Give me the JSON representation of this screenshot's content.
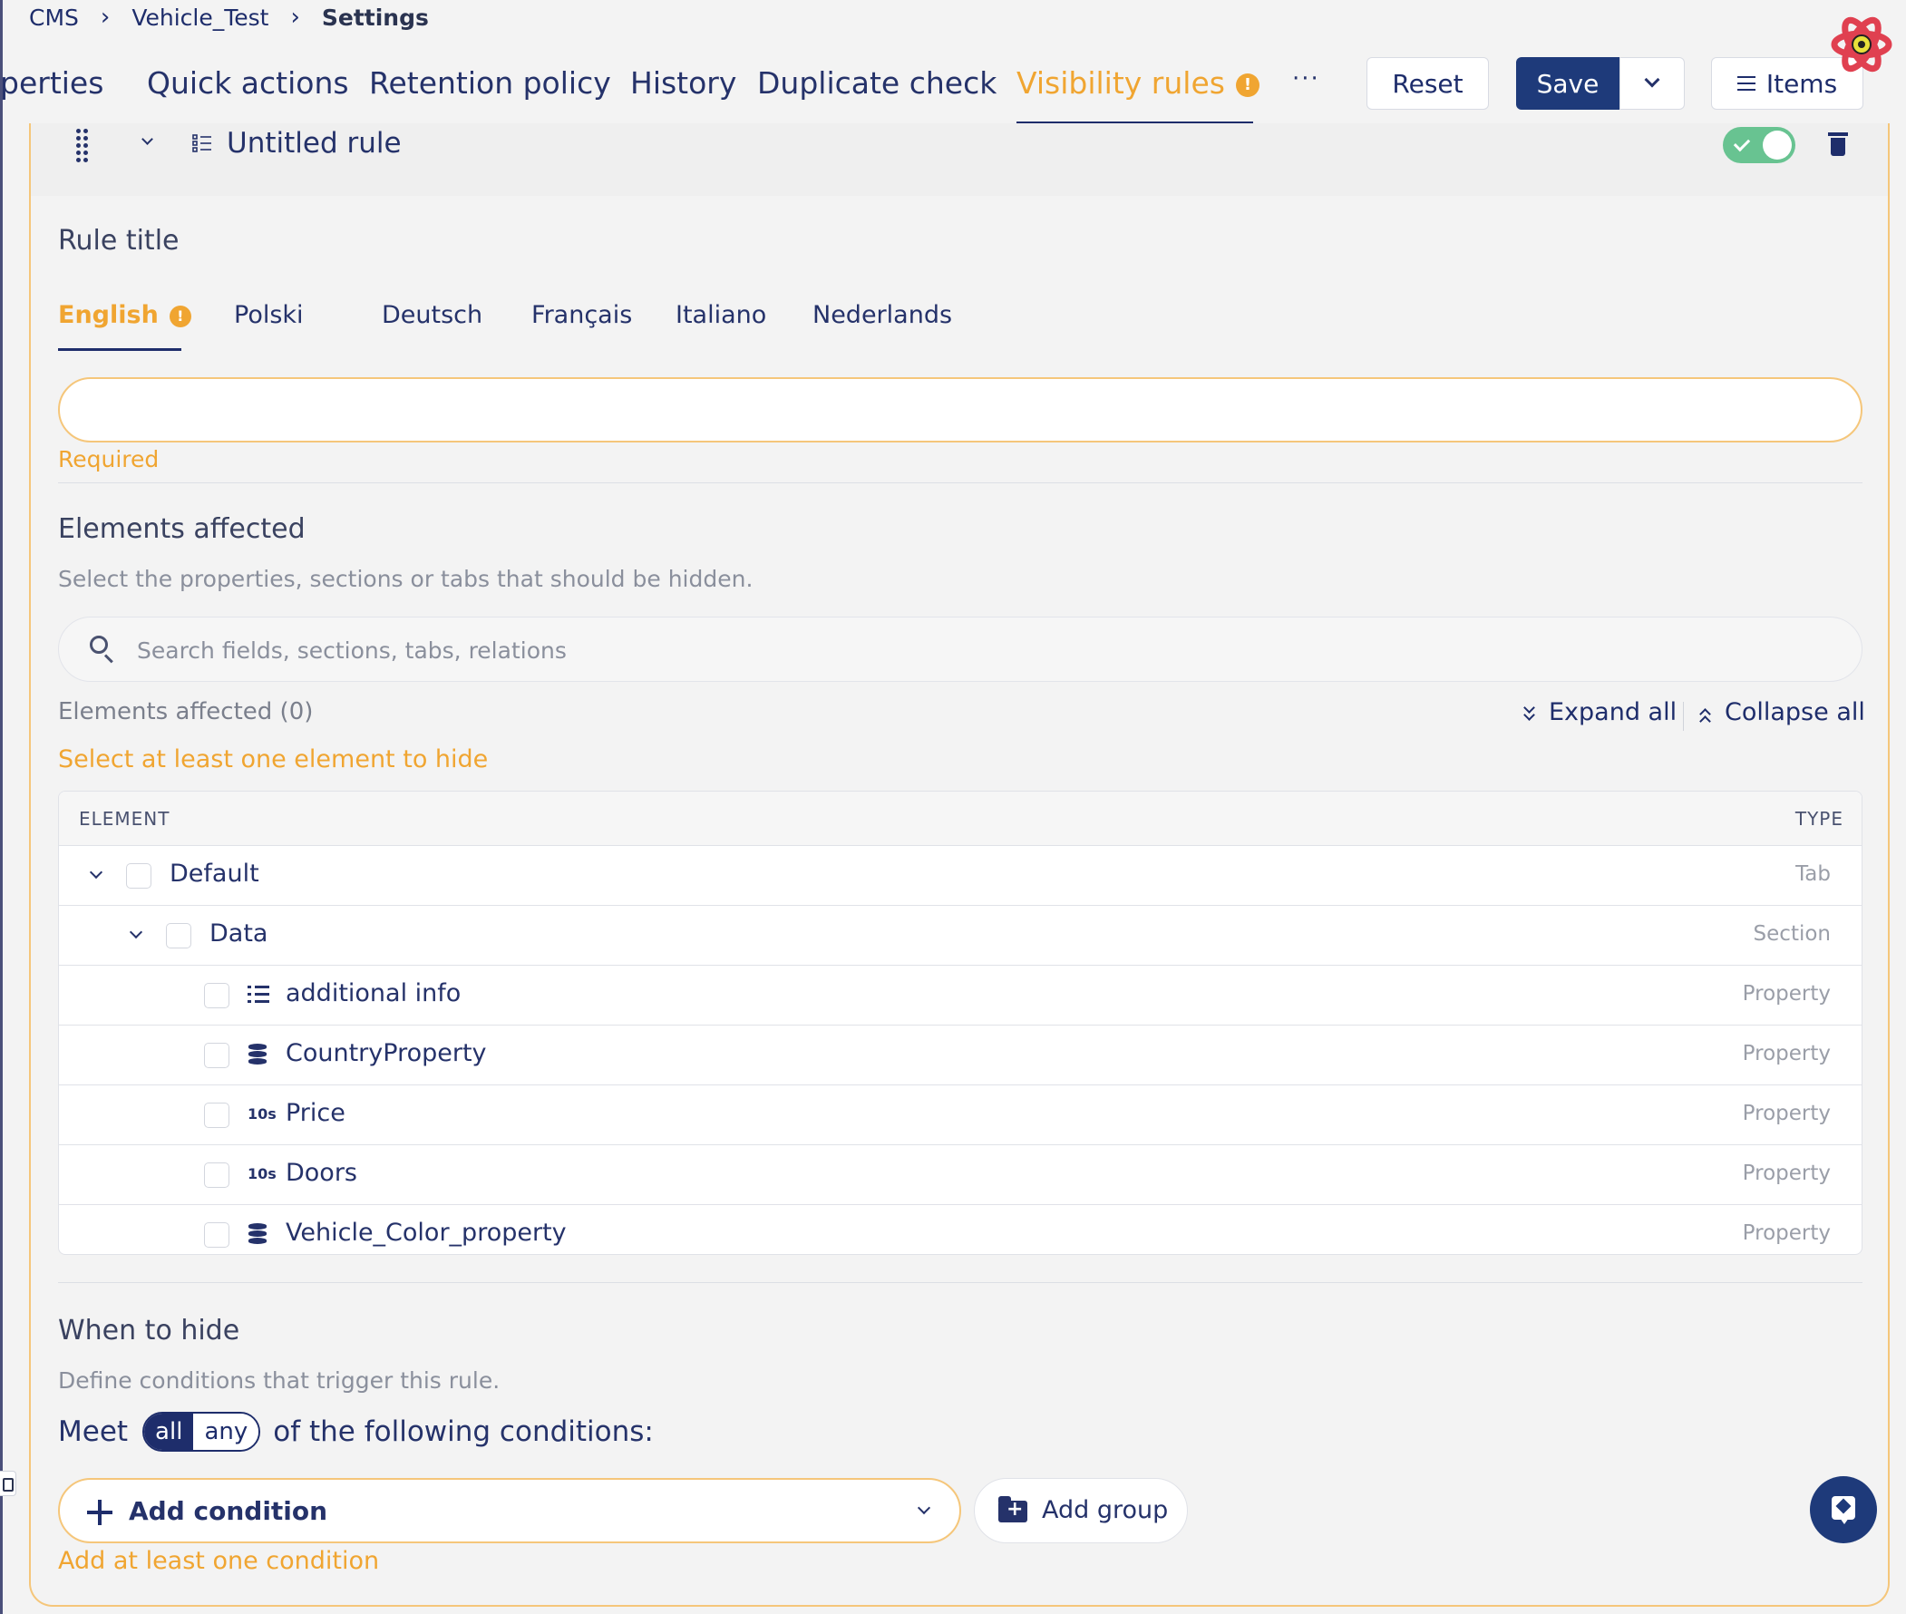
{
  "breadcrumb": {
    "items": [
      "CMS",
      "Vehicle_Test"
    ],
    "current": "Settings"
  },
  "tabs": {
    "properties": "perties",
    "quick_actions": "Quick actions",
    "retention_policy": "Retention policy",
    "history": "History",
    "duplicate_check": "Duplicate check",
    "visibility_rules": "Visibility rules",
    "more": "···"
  },
  "toolbar": {
    "reset": "Reset",
    "save": "Save",
    "items": "Items"
  },
  "rule": {
    "title": "Untitled rule",
    "enabled": true,
    "title_label": "Rule title",
    "languages": [
      "English",
      "Polski",
      "Deutsch",
      "Français",
      "Italiano",
      "Nederlands"
    ],
    "active_language": "English",
    "title_value": "",
    "title_error": "Required"
  },
  "elements": {
    "heading": "Elements affected",
    "description": "Select the properties, sections or tabs that should be hidden.",
    "search_placeholder": "Search fields, sections, tabs, relations",
    "count_label": "Elements affected (0)",
    "expand_all": "Expand all",
    "collapse_all": "Collapse all",
    "error": "Select at least one element to hide",
    "table": {
      "col_element": "ELEMENT",
      "col_type": "TYPE",
      "rows": [
        {
          "name": "Default",
          "type": "Tab",
          "icon": "chevron-down-icon"
        },
        {
          "name": "Data",
          "type": "Section",
          "icon": "chevron-down-icon"
        },
        {
          "name": "additional info",
          "type": "Property",
          "icon": "list-icon"
        },
        {
          "name": "CountryProperty",
          "type": "Property",
          "icon": "database-icon"
        },
        {
          "name": "Price",
          "type": "Property",
          "icon": "number-icon",
          "icon_text": "10s"
        },
        {
          "name": "Doors",
          "type": "Property",
          "icon": "number-icon",
          "icon_text": "10s"
        },
        {
          "name": "Vehicle_Color_property",
          "type": "Property",
          "icon": "database-icon"
        }
      ]
    }
  },
  "conditions": {
    "heading": "When to hide",
    "description": "Define conditions that trigger this rule.",
    "meet_prefix": "Meet",
    "meet_all": "all",
    "meet_any": "any",
    "meet_suffix": "of the following conditions:",
    "add_condition": "Add condition",
    "add_group": "Add group",
    "error": "Add at least one condition"
  },
  "colors": {
    "accent": "#f0a531",
    "primary": "#1e3a7a",
    "toggle_on": "#68c391"
  }
}
